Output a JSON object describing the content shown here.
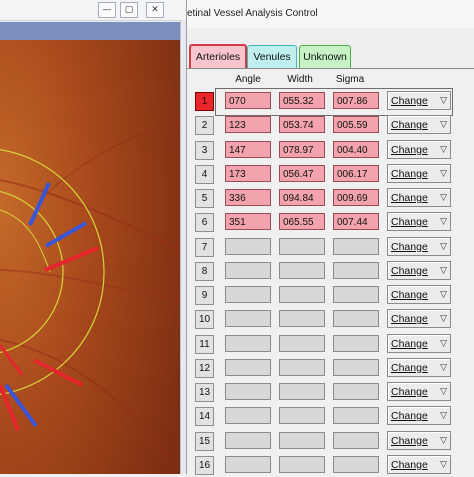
{
  "left_window": {
    "buttons": {
      "minimize": "—",
      "maximize": "▢",
      "close": "✕"
    }
  },
  "control_window": {
    "title": "etinal Vessel Analysis Control",
    "tabs": [
      "Arterioles",
      "Venules",
      "Unknown"
    ],
    "active_tab": "Arterioles",
    "columns": [
      "Angle",
      "Width",
      "Sigma"
    ],
    "change_label": "Change",
    "change_arrow": "▽",
    "rows": [
      {
        "num": "1",
        "angle": "070",
        "width": "055.32",
        "sigma": "007.86",
        "active": true
      },
      {
        "num": "2",
        "angle": "123",
        "width": "053.74",
        "sigma": "005.59"
      },
      {
        "num": "3",
        "angle": "147",
        "width": "078.97",
        "sigma": "004.40"
      },
      {
        "num": "4",
        "angle": "173",
        "width": "056.47",
        "sigma": "006.17"
      },
      {
        "num": "5",
        "angle": "336",
        "width": "094.84",
        "sigma": "009.69"
      },
      {
        "num": "6",
        "angle": "351",
        "width": "065.55",
        "sigma": "007.44"
      },
      {
        "num": "7",
        "angle": "",
        "width": "",
        "sigma": ""
      },
      {
        "num": "8",
        "angle": "",
        "width": "",
        "sigma": ""
      },
      {
        "num": "9",
        "angle": "",
        "width": "",
        "sigma": ""
      },
      {
        "num": "10",
        "angle": "",
        "width": "",
        "sigma": ""
      },
      {
        "num": "11",
        "angle": "",
        "width": "",
        "sigma": ""
      },
      {
        "num": "12",
        "angle": "",
        "width": "",
        "sigma": ""
      },
      {
        "num": "13",
        "angle": "",
        "width": "",
        "sigma": ""
      },
      {
        "num": "14",
        "angle": "",
        "width": "",
        "sigma": ""
      },
      {
        "num": "15",
        "angle": "",
        "width": "",
        "sigma": ""
      },
      {
        "num": "16",
        "angle": "",
        "width": "",
        "sigma": ""
      }
    ]
  },
  "colors": {
    "arteriole_fill": "#f3a3ad",
    "active_row": "#e8262c",
    "venule_tab": "#bff0ef",
    "unknown_tab": "#c7f2c5"
  }
}
